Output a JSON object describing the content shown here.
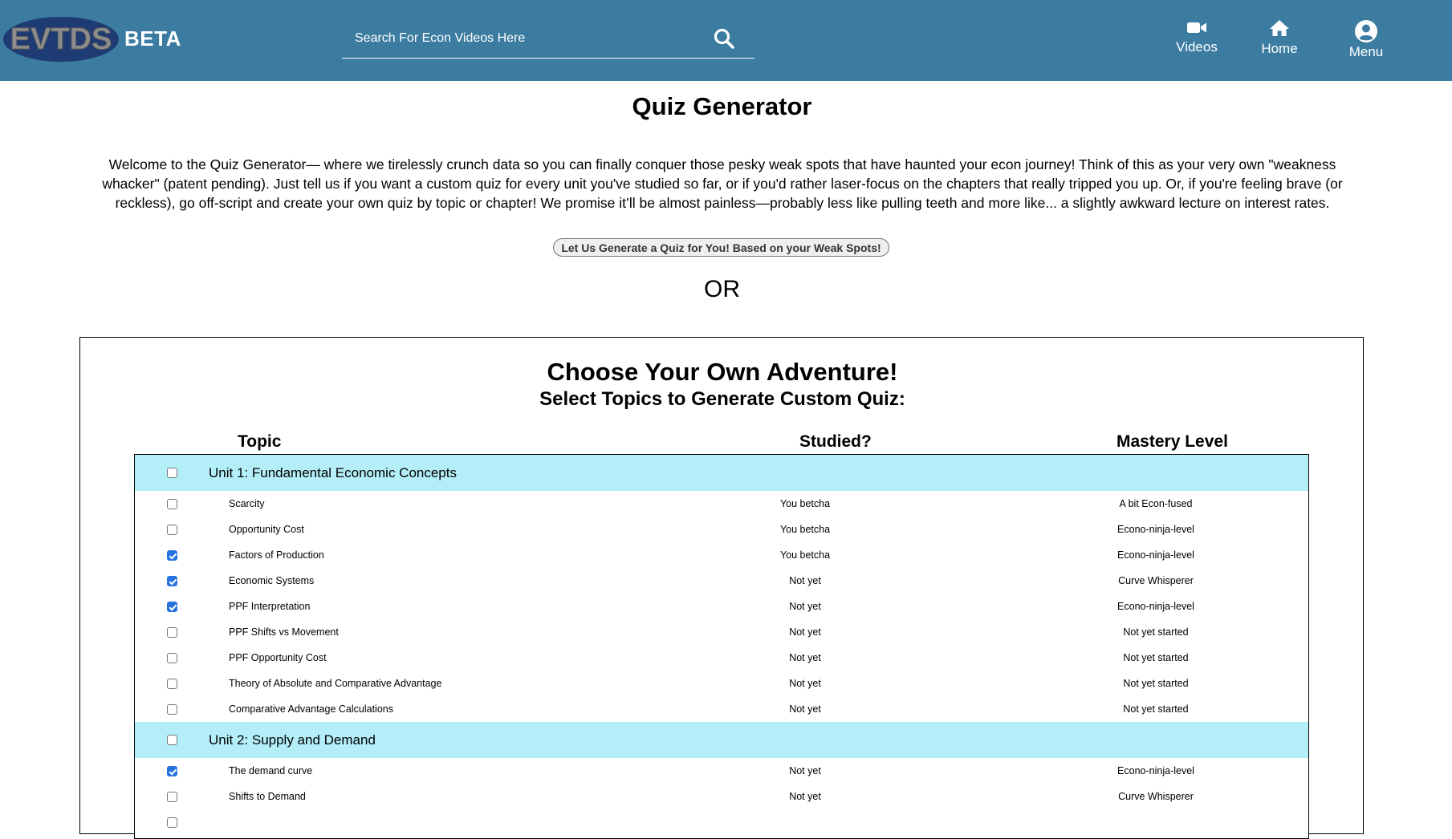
{
  "header": {
    "logo_text": "EVTDS",
    "beta_label": "BETA",
    "search_placeholder": "Search For Econ Videos Here",
    "nav": {
      "videos": "Videos",
      "home": "Home",
      "menu": "Menu"
    }
  },
  "main": {
    "title": "Quiz Generator",
    "intro": "Welcome to the Quiz Generator— where we tirelessly crunch data so you can finally conquer those pesky weak spots that have haunted your econ journey! Think of this as your very own \"weakness whacker\" (patent pending). Just tell us if you want a custom quiz for every unit you've studied so far, or if you'd rather laser-focus on the chapters that really tripped you up. Or, if you're feeling brave (or reckless), go off-script and create your own quiz by topic or chapter! We promise it’ll be almost painless—probably less like pulling teeth and more like... a slightly awkward lecture on interest rates.",
    "auto_button": "Let Us Generate a Quiz for You! Based on your Weak Spots!",
    "or_text": "OR"
  },
  "adventure": {
    "title": "Choose Your Own Adventure!",
    "subtitle": "Select Topics to Generate Custom Quiz:",
    "columns": {
      "topic": "Topic",
      "studied": "Studied?",
      "mastery": "Mastery Level"
    },
    "units": [
      {
        "name": "Unit 1: Fundamental Economic Concepts",
        "checked": false,
        "topics": [
          {
            "name": "Scarcity",
            "studied": "You betcha",
            "mastery": "A bit Econ-fused",
            "checked": false
          },
          {
            "name": "Opportunity Cost",
            "studied": "You betcha",
            "mastery": "Econo-ninja-level",
            "checked": false
          },
          {
            "name": "Factors of Production",
            "studied": "You betcha",
            "mastery": "Econo-ninja-level",
            "checked": true
          },
          {
            "name": "Economic Systems",
            "studied": "Not yet",
            "mastery": "Curve Whisperer",
            "checked": true
          },
          {
            "name": "PPF Interpretation",
            "studied": "Not yet",
            "mastery": "Econo-ninja-level",
            "checked": true
          },
          {
            "name": "PPF Shifts vs Movement",
            "studied": "Not yet",
            "mastery": "Not yet started",
            "checked": false
          },
          {
            "name": "PPF Opportunity Cost",
            "studied": "Not yet",
            "mastery": "Not yet started",
            "checked": false
          },
          {
            "name": "Theory of Absolute and Comparative Advantage",
            "studied": "Not yet",
            "mastery": "Not yet started",
            "checked": false
          },
          {
            "name": "Comparative Advantage Calculations",
            "studied": "Not yet",
            "mastery": "Not yet started",
            "checked": false
          }
        ]
      },
      {
        "name": "Unit 2: Supply and Demand",
        "checked": false,
        "topics": [
          {
            "name": "The demand curve",
            "studied": "Not yet",
            "mastery": "Econo-ninja-level",
            "checked": true
          },
          {
            "name": "Shifts to Demand",
            "studied": "Not yet",
            "mastery": "Curve Whisperer",
            "checked": false
          },
          {
            "name": "",
            "studied": "",
            "mastery": "",
            "checked": false
          }
        ]
      }
    ]
  },
  "colors": {
    "header_bg": "#3c7ca1",
    "unit_row_bg": "#b3eef9",
    "checkbox_checked": "#2672de",
    "logo_oval": "#1f3b73"
  },
  "icons": {
    "search": "search-icon",
    "videos": "video-camera-icon",
    "home": "home-icon",
    "menu": "user-circle-icon"
  }
}
